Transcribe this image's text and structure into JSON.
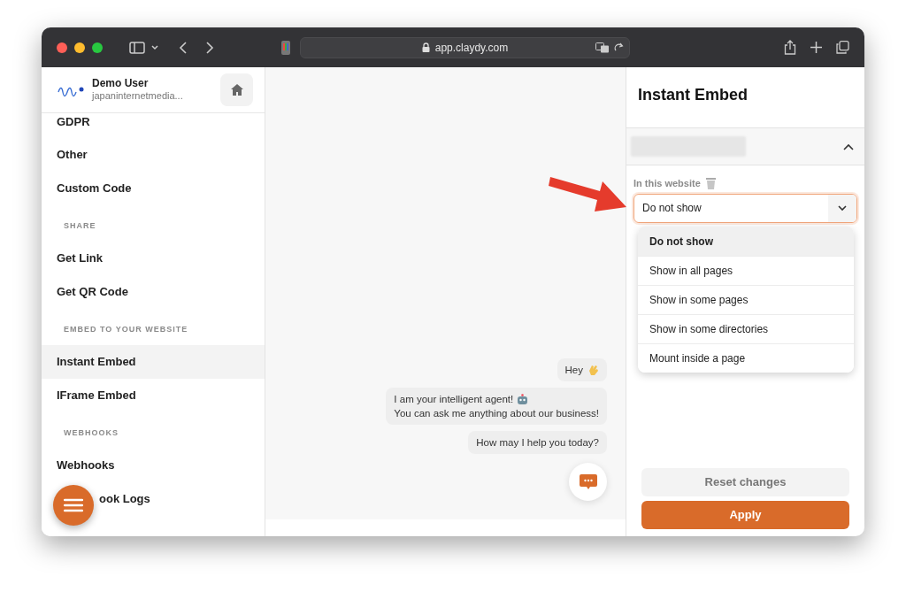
{
  "browser": {
    "url": "app.claydy.com"
  },
  "sidebar": {
    "user": {
      "name": "Demo User",
      "account": "japaninternetmedia..."
    },
    "items": [
      {
        "kind": "item",
        "label": "GDPR",
        "selected": false
      },
      {
        "kind": "item",
        "label": "Other",
        "selected": false
      },
      {
        "kind": "item",
        "label": "Custom Code",
        "selected": false
      },
      {
        "kind": "section",
        "label": "SHARE"
      },
      {
        "kind": "item",
        "label": "Get Link",
        "selected": false
      },
      {
        "kind": "item",
        "label": "Get QR Code",
        "selected": false
      },
      {
        "kind": "section",
        "label": "EMBED TO YOUR WEBSITE"
      },
      {
        "kind": "item",
        "label": "Instant Embed",
        "selected": true
      },
      {
        "kind": "item",
        "label": "IFrame Embed",
        "selected": false
      },
      {
        "kind": "section",
        "label": "WEBHOOKS"
      },
      {
        "kind": "item",
        "label": "Webhooks",
        "selected": false
      },
      {
        "kind": "partial",
        "label": "ook Logs",
        "selected": false
      }
    ]
  },
  "chat": {
    "messages": [
      {
        "kind": "greeting",
        "lines": [
          "Hey"
        ]
      },
      {
        "kind": "intro",
        "lines": [
          "I am your intelligent agent!",
          "You can ask me anything about our business!"
        ]
      },
      {
        "kind": "plain",
        "lines": [
          "How may I help you today?"
        ]
      }
    ]
  },
  "panel": {
    "title": "Instant Embed",
    "section": {
      "expanded": true
    },
    "field": {
      "label": "In this website",
      "value": "Do not show",
      "open": true,
      "options": [
        {
          "label": "Do not show",
          "selected": true
        },
        {
          "label": "Show in all pages",
          "selected": false
        },
        {
          "label": "Show in some pages",
          "selected": false
        },
        {
          "label": "Show in some directories",
          "selected": false
        },
        {
          "label": "Mount inside a page",
          "selected": false
        }
      ]
    },
    "buttons": [
      {
        "kind": "secondary",
        "label": "Reset changes"
      },
      {
        "kind": "primary",
        "label": "Apply"
      }
    ]
  }
}
